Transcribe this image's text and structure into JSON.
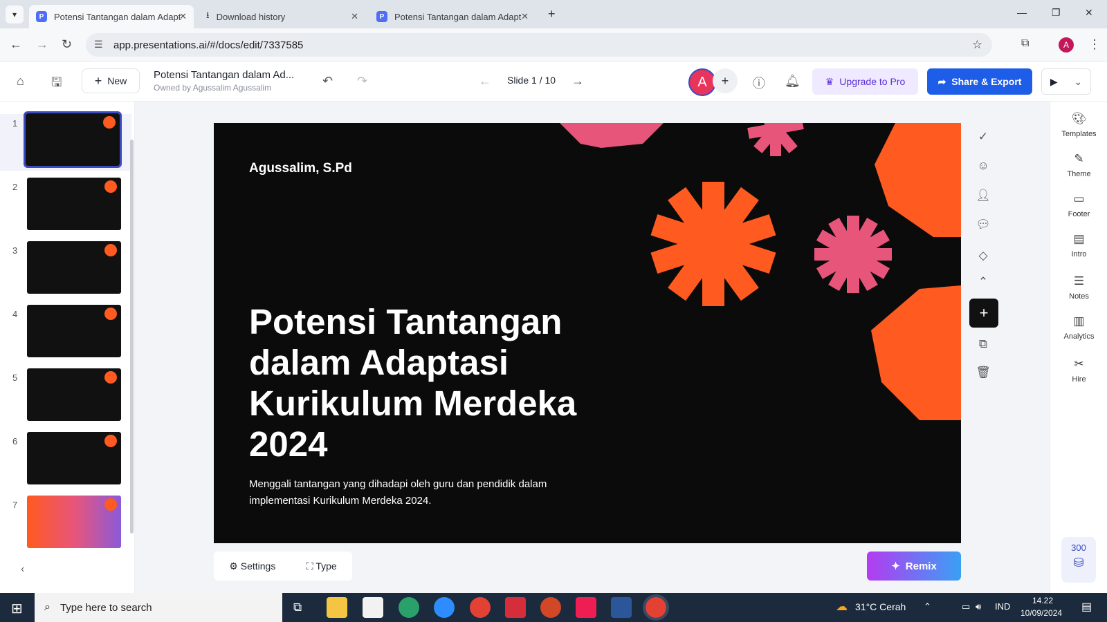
{
  "browser": {
    "tabs": [
      {
        "title": "Potensi Tantangan dalam Adapt",
        "active": true
      },
      {
        "title": "Download history",
        "active": false
      },
      {
        "title": "Potensi Tantangan dalam Adapt",
        "active": false
      }
    ],
    "url": "app.presentations.ai/#/docs/edit/7337585"
  },
  "header": {
    "new_label": "New",
    "doc_title": "Potensi Tantangan dalam Ad...",
    "owner": "Owned by Agussalim Agussalim",
    "slide_indicator": "Slide 1 / 10",
    "avatar_initial": "A",
    "upgrade_label": "Upgrade to Pro",
    "share_label": "Share & Export"
  },
  "thumbnails": [
    {
      "num": "1",
      "theme": "dark",
      "selected": true
    },
    {
      "num": "2",
      "theme": "dark"
    },
    {
      "num": "3",
      "theme": "dark"
    },
    {
      "num": "4",
      "theme": "dark"
    },
    {
      "num": "5",
      "theme": "dark"
    },
    {
      "num": "6",
      "theme": "dark"
    },
    {
      "num": "7",
      "theme": "colorful"
    }
  ],
  "slide": {
    "author": "Agussalim, S.Pd",
    "title": "Potensi Tantangan dalam Adaptasi Kurikulum Merdeka 2024",
    "subtitle": "Menggali tantangan yang dihadapi oleh guru dan pendidik dalam implementasi Kurikulum Merdeka 2024.",
    "colors": {
      "orange": "#ff5a1f",
      "pink": "#e8557a",
      "background": "#0b0b0b"
    }
  },
  "bottom": {
    "settings_label": "Settings",
    "type_label": "Type",
    "remix_label": "Remix"
  },
  "right_panel": {
    "items": [
      "Templates",
      "Theme",
      "Footer",
      "Intro",
      "Notes",
      "Analytics",
      "Hire"
    ],
    "credits": "300"
  },
  "taskbar": {
    "search_placeholder": "Type here to search",
    "weather": "31°C  Cerah",
    "language": "IND",
    "time": "14.22",
    "date": "10/09/2024"
  }
}
